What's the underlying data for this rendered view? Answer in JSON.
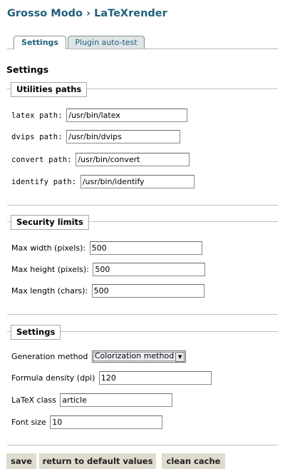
{
  "header": {
    "title": "Grosso Modo › LaTeXrender"
  },
  "tabs": [
    {
      "label": "Settings",
      "active": true
    },
    {
      "label": "Plugin auto-test",
      "active": false
    }
  ],
  "page_heading": "Settings",
  "utilities": {
    "legend": "Utilities paths",
    "latex": {
      "label": "latex path:",
      "value": "/usr/bin/latex"
    },
    "dvips": {
      "label": "dvips path:",
      "value": "/usr/bin/dvips"
    },
    "convert": {
      "label": "convert path:",
      "value": "/usr/bin/convert"
    },
    "identify": {
      "label": "identify path:",
      "value": "/usr/bin/identify"
    }
  },
  "security": {
    "legend": "Security limits",
    "max_width": {
      "label": "Max width (pixels):",
      "value": "500"
    },
    "max_height": {
      "label": "Max height (pixels):",
      "value": "500"
    },
    "max_length": {
      "label": "Max length (chars):",
      "value": "500"
    }
  },
  "settings": {
    "legend": "Settings",
    "method": {
      "label": "Generation method",
      "selected": "Colorization method"
    },
    "density": {
      "label": "Formula density (dpi)",
      "value": "120"
    },
    "latex_class": {
      "label": "LaTeX class",
      "value": "article"
    },
    "font_size": {
      "label": "Font size",
      "value": "10"
    }
  },
  "buttons": {
    "save": "save",
    "defaults": "return to default values",
    "clean": "clean cache"
  },
  "colors": {
    "title": "#20607a",
    "button_bg": "#dedbcf",
    "tab_inactive_bg": "#dfe4e7"
  }
}
